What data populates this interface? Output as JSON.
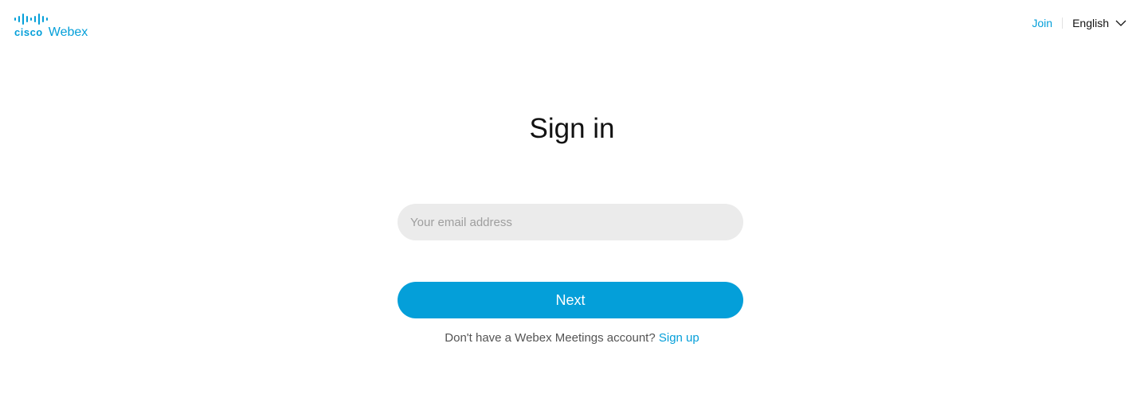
{
  "header": {
    "logo": {
      "brand": "cisco",
      "product": "Webex",
      "icon": "cisco-bars-logo",
      "color": "#049fd9"
    },
    "nav": {
      "join_label": "Join",
      "language_label": "English",
      "language_icon": "chevron-down-icon"
    }
  },
  "main": {
    "title": "Sign in",
    "email_placeholder": "Your email address",
    "email_value": "",
    "next_label": "Next",
    "signup_prompt": "Don't have a Webex Meetings account?",
    "signup_link": "Sign up"
  },
  "colors": {
    "accent": "#049fd9",
    "input_bg": "#ebebeb",
    "text": "#121212",
    "muted_text": "#545454"
  }
}
